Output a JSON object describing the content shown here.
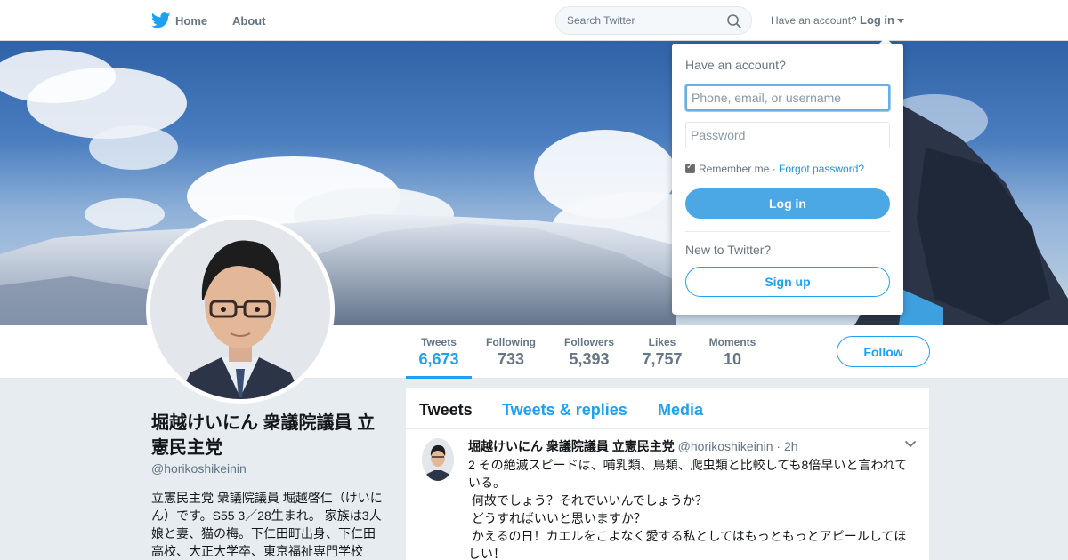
{
  "nav": {
    "home": "Home",
    "about": "About",
    "search_placeholder": "Search Twitter",
    "have_account": "Have an account?",
    "login": "Log in"
  },
  "profile": {
    "name": "堀越けいにん 衆議院議員 立憲民主党",
    "handle": "@horikoshikeinin",
    "bio": "立憲民主党 衆議院議員 堀越啓仁（けいにん）です。S55 3／28生まれ。 家族は3人娘と妻、猫の梅。下仁田町出身、下仁田高校、大正大学卒、東京福祉専門学校"
  },
  "stats": [
    {
      "label": "Tweets",
      "value": "6,673"
    },
    {
      "label": "Following",
      "value": "733"
    },
    {
      "label": "Followers",
      "value": "5,393"
    },
    {
      "label": "Likes",
      "value": "7,757"
    },
    {
      "label": "Moments",
      "value": "10"
    }
  ],
  "follow_label": "Follow",
  "tabs": [
    "Tweets",
    "Tweets & replies",
    "Media"
  ],
  "tweet": {
    "name": "堀越けいにん 衆議院議員 立憲民主党",
    "handle": "@horikoshikeinin",
    "time": "· 2h",
    "lines": [
      "2 その絶滅スピードは、哺乳類、鳥類、爬虫類と比較しても8倍早いと言われている。",
      " 何故でしょう？それでいいんでしょうか？",
      " どうすればいいと思いますか？",
      " かえるの日！カエルをこよなく愛する私としてはもっともっとアピールしてほしい！"
    ]
  },
  "login_dropdown": {
    "title": "Have an account?",
    "username_placeholder": "Phone, email, or username",
    "password_placeholder": "Password",
    "remember": "Remember me",
    "separator": " · ",
    "forgot": "Forgot password?",
    "login_button": "Log in",
    "new_to_twitter": "New to Twitter?",
    "signup_button": "Sign up"
  },
  "colors": {
    "accent": "#1da1f2",
    "login_button": "#4ba8e4",
    "page_bg": "#e6ecf0"
  }
}
